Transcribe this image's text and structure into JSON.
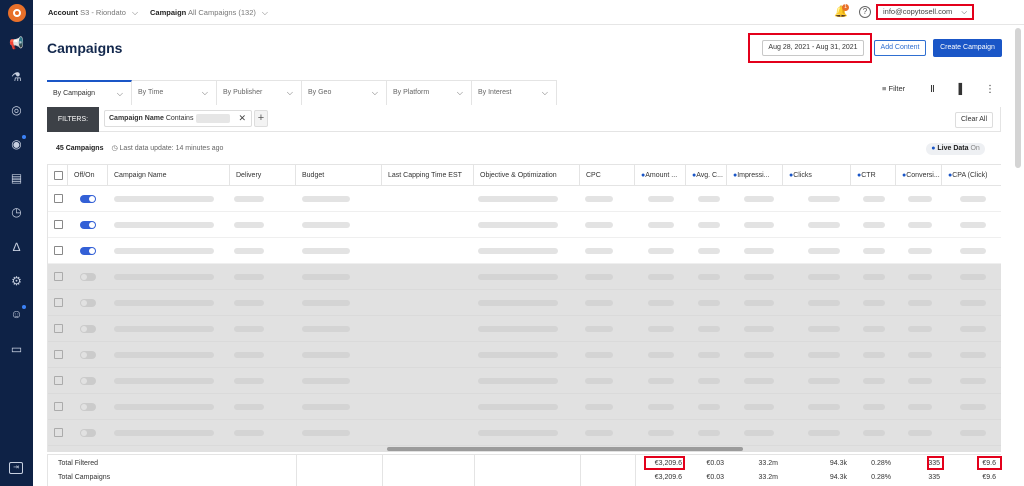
{
  "topbar": {
    "account_label": "Account",
    "account_value": "S3 - Riondato",
    "campaign_label": "Campaign",
    "campaign_value": "All Campaigns (132)",
    "notification_count": "1",
    "user_email": "info@copytosell.com"
  },
  "header": {
    "title": "Campaigns",
    "date_range": "Aug 28, 2021 - Aug 31, 2021",
    "add_content_label": "Add Content",
    "create_campaign_label": "Create Campaign"
  },
  "tabs": [
    "By Campaign",
    "By Time",
    "By Publisher",
    "By Geo",
    "By Platform",
    "By Interest"
  ],
  "tools": {
    "filter_label": "Filter"
  },
  "filters": {
    "label": "FILTERS:",
    "chip_field": "Campaign Name",
    "chip_op": "Contains",
    "clear_label": "Clear All"
  },
  "summary": {
    "count": "45 Campaigns",
    "last_update": "Last data update: 14 minutes ago",
    "live_label": "Live Data",
    "live_state": "On"
  },
  "columns": [
    "Off/On",
    "Campaign Name",
    "Delivery",
    "Budget",
    "Last Capping Time EST",
    "Objective & Optimization",
    "CPC",
    "Amount ...",
    "Avg. C...",
    "Impressi...",
    "Clicks",
    "CTR",
    "Conversi...",
    "CPA (Click)"
  ],
  "rows_toggle_on": [
    true,
    true,
    true,
    false,
    false,
    false,
    false,
    false,
    false,
    false
  ],
  "totals": {
    "filtered_label": "Total Filtered",
    "campaigns_label": "Total Campaigns",
    "filtered": {
      "amount": "€3,209.6",
      "avg_cpc": "€0.03",
      "impressions": "33.2m",
      "clicks": "94.3k",
      "ctr": "0.28%",
      "conversions": "335",
      "cpa": "€9.6"
    },
    "campaigns": {
      "amount": "€3,209.6",
      "avg_cpc": "€0.03",
      "impressions": "33.2m",
      "clicks": "94.3k",
      "ctr": "0.28%",
      "conversions": "335",
      "cpa": "€9.6"
    }
  },
  "colors": {
    "sidebar": "#0e2246",
    "accent": "#1a56c7",
    "highlight": "#e3001b",
    "logo": "#e8702a"
  }
}
